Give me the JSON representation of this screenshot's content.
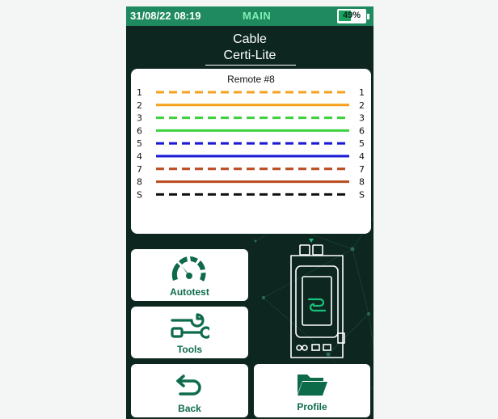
{
  "status_bar": {
    "datetime": "31/08/22 08:19",
    "mode": "MAIN",
    "battery_percent": "49%",
    "battery_level": 0.49
  },
  "cable": {
    "title": "Cable",
    "name": "Certi-Lite"
  },
  "wiremap": {
    "title": "Remote #8",
    "wires": [
      {
        "left": "1",
        "right": "1",
        "color": "#f5a11c",
        "style": "dashed"
      },
      {
        "left": "2",
        "right": "2",
        "color": "#f5a11c",
        "style": "solid"
      },
      {
        "left": "3",
        "right": "3",
        "color": "#3ed13e",
        "style": "dashed"
      },
      {
        "left": "6",
        "right": "6",
        "color": "#3ed13e",
        "style": "solid"
      },
      {
        "left": "5",
        "right": "5",
        "color": "#1a1ad6",
        "style": "dashed"
      },
      {
        "left": "4",
        "right": "4",
        "color": "#1a1ad6",
        "style": "solid"
      },
      {
        "left": "7",
        "right": "7",
        "color": "#b94a1f",
        "style": "dashed"
      },
      {
        "left": "8",
        "right": "8",
        "color": "#b94a1f",
        "style": "solid"
      },
      {
        "left": "S",
        "right": "S",
        "color": "#111111",
        "style": "dashed"
      }
    ]
  },
  "tiles": {
    "autotest": {
      "label": "Autotest",
      "icon": "gauge-icon"
    },
    "tools": {
      "label": "Tools",
      "icon": "wrench-tools-icon"
    },
    "back": {
      "label": "Back",
      "icon": "back-arrow-icon"
    },
    "profile": {
      "label": "Profile",
      "icon": "folder-icon"
    }
  },
  "colors": {
    "screen_bg": "#0d2620",
    "status_bar": "#1f8a5f",
    "accent": "#0d6b4a"
  }
}
